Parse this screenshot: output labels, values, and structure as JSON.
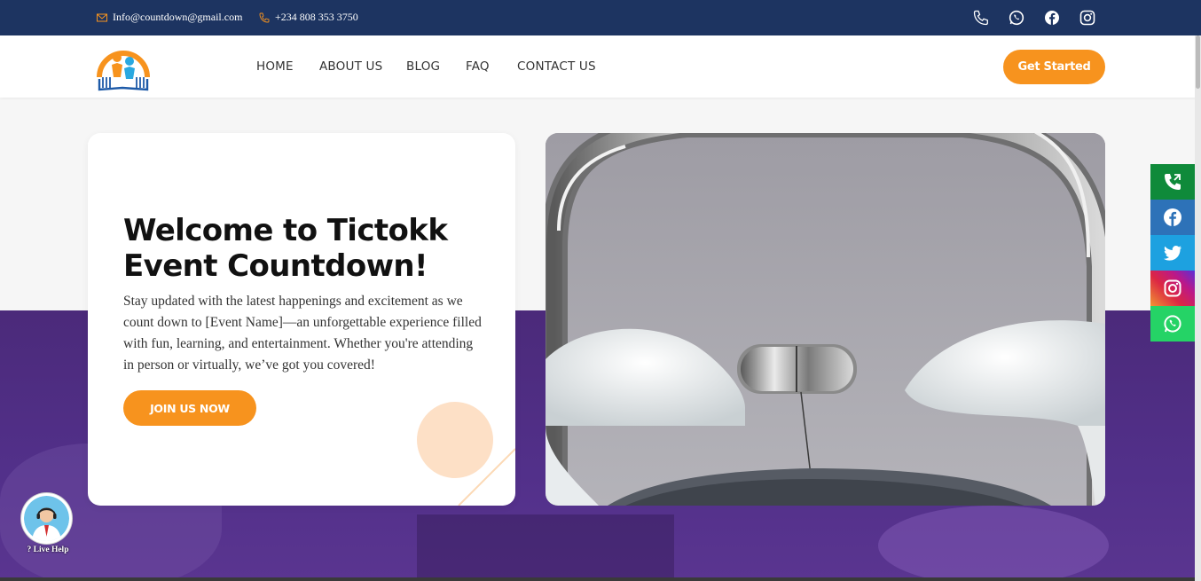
{
  "topbar": {
    "email": "Info@countdown@gmail.com",
    "phone": "+234 808 353 3750",
    "social_icons": [
      "phone-icon",
      "whatsapp-icon",
      "facebook-icon",
      "instagram-icon"
    ]
  },
  "nav": {
    "items": [
      {
        "label": "HOME"
      },
      {
        "label": "ABOUT US"
      },
      {
        "label": "BLOG"
      },
      {
        "label": "FAQ"
      },
      {
        "label": "CONTACT US"
      }
    ],
    "cta_label": "Get Started"
  },
  "hero": {
    "title": "Welcome to Tictokk Event Countdown!",
    "description": "Stay updated with the latest happenings and excitement as we count down to [Event Name]—an unforgettable experience filled with fun, learning, and entertainment. Whether you're attending in person or virtually, we’ve got you covered!",
    "button_label": "JOIN US NOW"
  },
  "floating_social": [
    {
      "icon": "phone-call-icon",
      "color": "#0f8a3a"
    },
    {
      "icon": "facebook-icon",
      "color": "#2d72b8"
    },
    {
      "icon": "twitter-icon",
      "color": "#1da1e0"
    },
    {
      "icon": "instagram-icon",
      "color": "#c13584"
    },
    {
      "icon": "whatsapp-icon",
      "color": "#25d366"
    }
  ],
  "live_help": {
    "label": "? Live Help"
  },
  "colors": {
    "topbar": "#1d3461",
    "accent": "#f7931e",
    "hero_purple": "#4b2a7a"
  }
}
